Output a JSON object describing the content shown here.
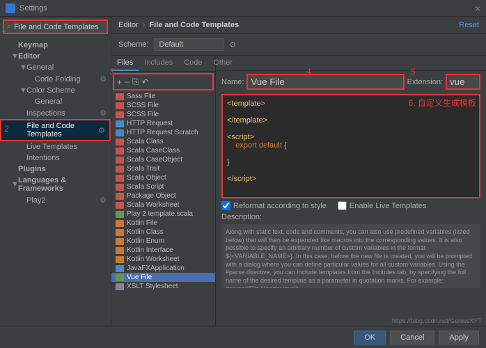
{
  "title": "Settings",
  "search": {
    "placeholder": "File and Code Templates"
  },
  "sidebar": {
    "items": [
      {
        "label": "Keymap",
        "bold": true,
        "caret": ""
      },
      {
        "label": "Editor",
        "bold": true,
        "caret": "▼"
      },
      {
        "label": "General",
        "caret": "▼",
        "indent": 1
      },
      {
        "label": "Code Folding",
        "indent": 2,
        "gear": true
      },
      {
        "label": "Color Scheme",
        "caret": "▼",
        "indent": 1
      },
      {
        "label": "General",
        "indent": 2
      },
      {
        "label": "Inspections",
        "indent": 1,
        "gear": true
      },
      {
        "label": "File and Code Templates",
        "indent": 1,
        "selected": true,
        "gear": true
      },
      {
        "label": "Live Templates",
        "indent": 1
      },
      {
        "label": "Intentions",
        "indent": 1
      },
      {
        "label": "Plugins",
        "bold": true
      },
      {
        "label": "Languages & Frameworks",
        "bold": true,
        "caret": "▼"
      },
      {
        "label": "Play2",
        "indent": 1,
        "gear": true
      }
    ]
  },
  "breadcrumb": {
    "root": "Editor",
    "leaf": "File and Code Templates"
  },
  "reset_label": "Reset",
  "scheme": {
    "label": "Scheme:",
    "value": "Default"
  },
  "tabs": [
    "Files",
    "Includes",
    "Code",
    "Other"
  ],
  "toolbar": {
    "add": "+",
    "remove": "−",
    "copy": "⎘",
    "undo": "↶"
  },
  "file_list": [
    {
      "label": "Sass File",
      "icon": "fi-red"
    },
    {
      "label": "SCSS File",
      "icon": "fi-red"
    },
    {
      "label": "SCSS File",
      "icon": "fi-red"
    },
    {
      "label": "HTTP Request",
      "icon": "fi-blue"
    },
    {
      "label": "HTTP Request Scratch",
      "icon": "fi-blue"
    },
    {
      "label": "Scala Class",
      "icon": "fi-red"
    },
    {
      "label": "Scala CaseClass",
      "icon": "fi-red"
    },
    {
      "label": "Scala CaseObject",
      "icon": "fi-red"
    },
    {
      "label": "Scala Trait",
      "icon": "fi-red"
    },
    {
      "label": "Scala Object",
      "icon": "fi-red"
    },
    {
      "label": "Scala Script",
      "icon": "fi-red"
    },
    {
      "label": "Package Object",
      "icon": "fi-red"
    },
    {
      "label": "Scala Worksheet",
      "icon": "fi-red"
    },
    {
      "label": "Play 2 template.scala",
      "icon": "fi-green"
    },
    {
      "label": "Kotlin File",
      "icon": "fi-orange"
    },
    {
      "label": "Kotlin Class",
      "icon": "fi-orange"
    },
    {
      "label": "Kotlin Enum",
      "icon": "fi-orange"
    },
    {
      "label": "Kotlin Interface",
      "icon": "fi-orange"
    },
    {
      "label": "Kotlin Worksheet",
      "icon": "fi-orange"
    },
    {
      "label": "JavaFXApplication",
      "icon": "fi-blue"
    },
    {
      "label": "Vue File",
      "icon": "fi-green",
      "selected": true
    },
    {
      "label": "XSLT Stylesheet",
      "icon": "fi-purple"
    }
  ],
  "name_field": {
    "label": "Name:",
    "value": "Vue File"
  },
  "ext_field": {
    "label": "Extension:",
    "value": "vue"
  },
  "editor_lines": [
    "<template>",
    "",
    "</template>",
    "",
    "<script>",
    "    export default {",
    "",
    "    }",
    "",
    "</script>"
  ],
  "opts": {
    "reformat": "Reformat according to style",
    "live": "Enable Live Templates"
  },
  "description": {
    "label": "Description:",
    "text": "Along with static text, code and comments, you can also use predefined variables (listed below) that will then be expanded like macros into the corresponding values. It is also possible to specify an arbitrary number of custom variables in the format ${<VARIABLE_NAME>}. In this case, before the new file is created, you will be prompted with a dialog where you can define particular values for all custom variables.\nUsing the #parse directive, you can include templates from the Includes tab, by specifying the full name of the desired template as a parameter in quotation marks. For example:\n#parse(\"File Header.java\")"
  },
  "buttons": {
    "ok": "OK",
    "cancel": "Cancel",
    "apply": "Apply"
  },
  "annotations": {
    "n1": "1",
    "n2": "2",
    "n3": "3",
    "n4": "4",
    "n5": "5",
    "n6": "6. 自定义生成模板"
  },
  "watermark": "https://blog.csdn.net/GeniusXYT"
}
